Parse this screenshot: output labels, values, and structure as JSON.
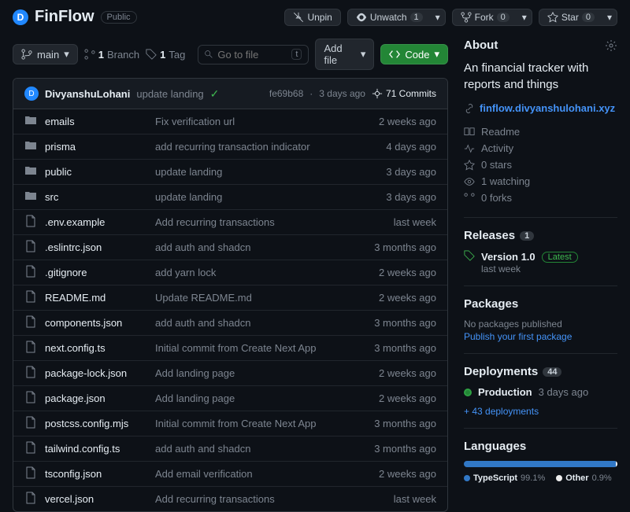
{
  "repo": {
    "name": "FinFlow",
    "visibility": "Public"
  },
  "actions": {
    "unpin": "Unpin",
    "unwatch": "Unwatch",
    "unwatch_count": "1",
    "fork": "Fork",
    "fork_count": "0",
    "star": "Star",
    "star_count": "0"
  },
  "branch": {
    "name": "main",
    "branches": "1",
    "branches_label": "Branch",
    "tags": "1",
    "tags_label": "Tag"
  },
  "search_placeholder": "Go to file",
  "addfile": "Add file",
  "code": "Code",
  "commit": {
    "author": "DivyanshuLohani",
    "message": "update landing",
    "sha": "fe69b68",
    "time": "3 days ago",
    "count": "71 Commits"
  },
  "files": [
    {
      "type": "dir",
      "name": "emails",
      "msg": "Fix verification url",
      "time": "2 weeks ago"
    },
    {
      "type": "dir",
      "name": "prisma",
      "msg": "add recurring transaction indicator",
      "time": "4 days ago"
    },
    {
      "type": "dir",
      "name": "public",
      "msg": "update landing",
      "time": "3 days ago"
    },
    {
      "type": "dir",
      "name": "src",
      "msg": "update landing",
      "time": "3 days ago"
    },
    {
      "type": "file",
      "name": ".env.example",
      "msg": "Add recurring transactions",
      "time": "last week"
    },
    {
      "type": "file",
      "name": ".eslintrc.json",
      "msg": "add auth and shadcn",
      "time": "3 months ago"
    },
    {
      "type": "file",
      "name": ".gitignore",
      "msg": "add yarn lock",
      "time": "2 weeks ago"
    },
    {
      "type": "file",
      "name": "README.md",
      "msg": "Update README.md",
      "time": "2 weeks ago"
    },
    {
      "type": "file",
      "name": "components.json",
      "msg": "add auth and shadcn",
      "time": "3 months ago"
    },
    {
      "type": "file",
      "name": "next.config.ts",
      "msg": "Initial commit from Create Next App",
      "time": "3 months ago"
    },
    {
      "type": "file",
      "name": "package-lock.json",
      "msg": "Add landing page",
      "time": "2 weeks ago"
    },
    {
      "type": "file",
      "name": "package.json",
      "msg": "Add landing page",
      "time": "2 weeks ago"
    },
    {
      "type": "file",
      "name": "postcss.config.mjs",
      "msg": "Initial commit from Create Next App",
      "time": "3 months ago"
    },
    {
      "type": "file",
      "name": "tailwind.config.ts",
      "msg": "add auth and shadcn",
      "time": "3 months ago"
    },
    {
      "type": "file",
      "name": "tsconfig.json",
      "msg": "Add email verification",
      "time": "2 weeks ago"
    },
    {
      "type": "file",
      "name": "vercel.json",
      "msg": "Add recurring transactions",
      "time": "last week"
    }
  ],
  "about": {
    "title": "About",
    "desc": "An financial tracker with reports and things",
    "url": "finflow.divyanshulohani.xyz",
    "readme": "Readme",
    "activity": "Activity",
    "stars": "0 stars",
    "watching": "1 watching",
    "forks": "0 forks"
  },
  "releases": {
    "title": "Releases",
    "count": "1",
    "name": "Version 1.0",
    "badge": "Latest",
    "time": "last week"
  },
  "packages": {
    "title": "Packages",
    "none": "No packages published",
    "link": "Publish your first package"
  },
  "deployments": {
    "title": "Deployments",
    "count": "44",
    "env": "Production",
    "time": "3 days ago",
    "more": "+ 43 deployments"
  },
  "languages": {
    "title": "Languages",
    "items": [
      {
        "name": "TypeScript",
        "pct": "99.1%",
        "color": "#3178c6"
      },
      {
        "name": "Other",
        "pct": "0.9%",
        "color": "#ededed"
      }
    ]
  }
}
